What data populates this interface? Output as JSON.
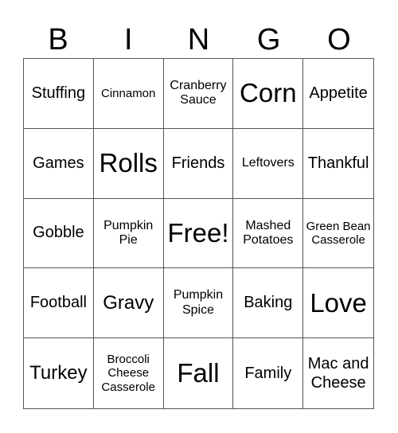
{
  "header": {
    "letters": [
      "B",
      "I",
      "N",
      "G",
      "O"
    ]
  },
  "cells": [
    {
      "text": "Stuffing",
      "size": "s3"
    },
    {
      "text": "Cinnamon",
      "size": "s1"
    },
    {
      "text": "Cranberry Sauce",
      "size": "s2"
    },
    {
      "text": "Corn",
      "size": "s5"
    },
    {
      "text": "Appetite",
      "size": "s3"
    },
    {
      "text": "Games",
      "size": "s3"
    },
    {
      "text": "Rolls",
      "size": "s5"
    },
    {
      "text": "Friends",
      "size": "s3"
    },
    {
      "text": "Leftovers",
      "size": "s2"
    },
    {
      "text": "Thankful",
      "size": "s3"
    },
    {
      "text": "Gobble",
      "size": "s3"
    },
    {
      "text": "Pumpkin Pie",
      "size": "s2"
    },
    {
      "text": "Free!",
      "size": "s5"
    },
    {
      "text": "Mashed Potatoes",
      "size": "s2"
    },
    {
      "text": "Green Bean Casserole",
      "size": "s1"
    },
    {
      "text": "Football",
      "size": "s3"
    },
    {
      "text": "Gravy",
      "size": "s4"
    },
    {
      "text": "Pumpkin Spice",
      "size": "s2"
    },
    {
      "text": "Baking",
      "size": "s3"
    },
    {
      "text": "Love",
      "size": "s5"
    },
    {
      "text": "Turkey",
      "size": "s4"
    },
    {
      "text": "Broccoli Cheese Casserole",
      "size": "s1"
    },
    {
      "text": "Fall",
      "size": "s5"
    },
    {
      "text": "Family",
      "size": "s3"
    },
    {
      "text": "Mac and Cheese",
      "size": "s6"
    }
  ]
}
